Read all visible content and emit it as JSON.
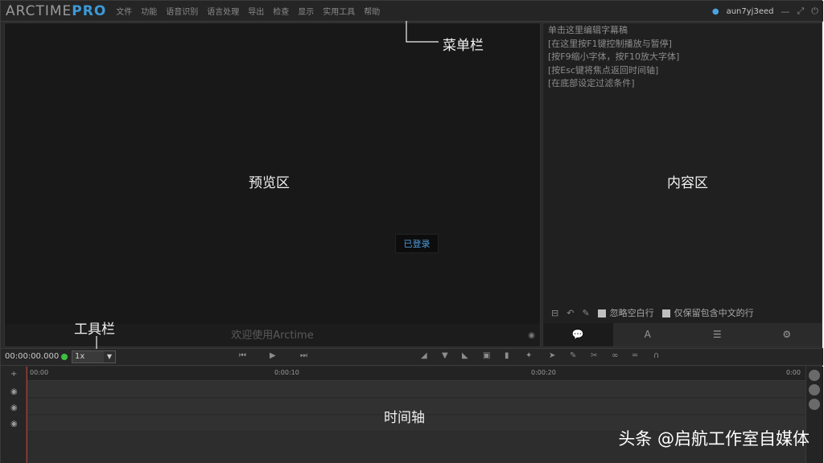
{
  "app": {
    "logo_main": "ARCTIME",
    "logo_accent": "PRO",
    "menu": [
      "文件",
      "功能",
      "语音识别",
      "语言处理",
      "导出",
      "检查",
      "显示",
      "实用工具",
      "帮助"
    ],
    "username": "aun7yj3eed",
    "win_buttons": [
      "—",
      "⤢",
      "⏻"
    ]
  },
  "preview": {
    "welcome": "欢迎使用Arctime",
    "logged_in_badge": "已登录"
  },
  "content": {
    "lines": [
      "单击这里编辑字幕稿",
      "[在这里按F1键控制播放与暂停]",
      "[按F9缩小字体，按F10放大字体]",
      "[按Esc键将焦点返回时间轴]",
      "[在底部设定过滤条件]"
    ],
    "opt_ignore_empty": "忽略空白行",
    "opt_keep_chinese": "仅保留包含中文的行",
    "tabs": [
      "💬",
      "A",
      "☰",
      "⚙"
    ]
  },
  "toolbar": {
    "timecode": "00:00:00.000",
    "speed": "1x"
  },
  "timeline": {
    "ruler_labels": [
      "00:00",
      "0:00:10",
      "0:00:20",
      "0:00"
    ]
  },
  "annotations": {
    "menubar": "菜单栏",
    "preview": "预览区",
    "content": "内容区",
    "toolbar": "工具栏",
    "timeline": "时间轴"
  },
  "watermark": "头条 @启航工作室自媒体",
  "colors": {
    "accent_blue": "#3b9ad9",
    "status_green": "#3fbf3f",
    "playhead_red": "#c0392b"
  }
}
